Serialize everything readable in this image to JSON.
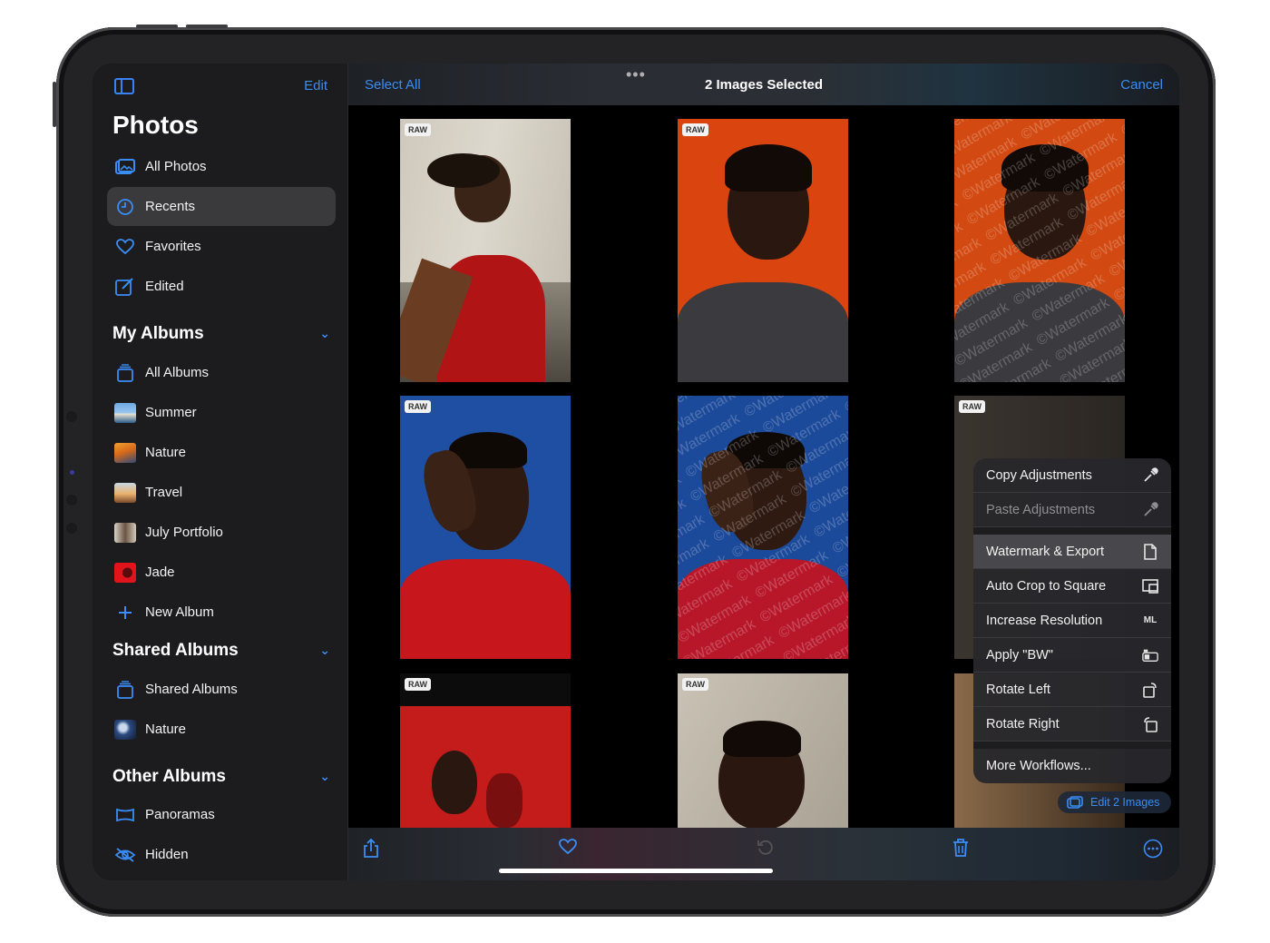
{
  "sidebar": {
    "edit_label": "Edit",
    "title": "Photos",
    "library": [
      {
        "label": "All Photos",
        "icon": "photos-icon"
      },
      {
        "label": "Recents",
        "icon": "clock-icon",
        "active": true
      },
      {
        "label": "Favorites",
        "icon": "heart-icon"
      },
      {
        "label": "Edited",
        "icon": "edit-icon"
      }
    ],
    "my_albums": {
      "title": "My Albums",
      "items": [
        "All Albums",
        "Summer",
        "Nature",
        "Travel",
        "July Portfolio",
        "Jade",
        "New Album"
      ]
    },
    "shared_albums": {
      "title": "Shared Albums",
      "items": [
        "Shared Albums",
        "Nature"
      ]
    },
    "other_albums": {
      "title": "Other Albums",
      "items": [
        "Panoramas",
        "Hidden"
      ]
    }
  },
  "topbar": {
    "select_all": "Select All",
    "more_dots": "•••",
    "title": "2 Images Selected",
    "cancel": "Cancel"
  },
  "photos": {
    "raw_badge": "RAW",
    "watermark_text": "©Watermark"
  },
  "menu": {
    "items": [
      {
        "label": "Copy Adjustments",
        "icon": "eyedropper-icon"
      },
      {
        "label": "Paste Adjustments",
        "icon": "eyedropper-icon",
        "disabled": true
      },
      {
        "label": "Watermark & Export",
        "icon": "document-icon",
        "highlighted": true
      },
      {
        "label": "Auto Crop to Square",
        "icon": "crop-icon"
      },
      {
        "label": "Increase Resolution",
        "icon": "ml-sparkle-icon"
      },
      {
        "label": "Apply \"BW\"",
        "icon": "preset-icon"
      },
      {
        "label": "Rotate Left",
        "icon": "rotate-left-icon"
      },
      {
        "label": "Rotate Right",
        "icon": "rotate-right-icon"
      },
      {
        "label": "More Workflows...",
        "icon": ""
      }
    ]
  },
  "edit_pill": {
    "label": "Edit 2 Images"
  },
  "colors": {
    "accent": "#3b8df6",
    "sidebar_bg": "#1c1c1e",
    "orange_bg": "#d9440f",
    "blue_bg": "#1c4a9a",
    "red_shirt": "#c8161d"
  }
}
